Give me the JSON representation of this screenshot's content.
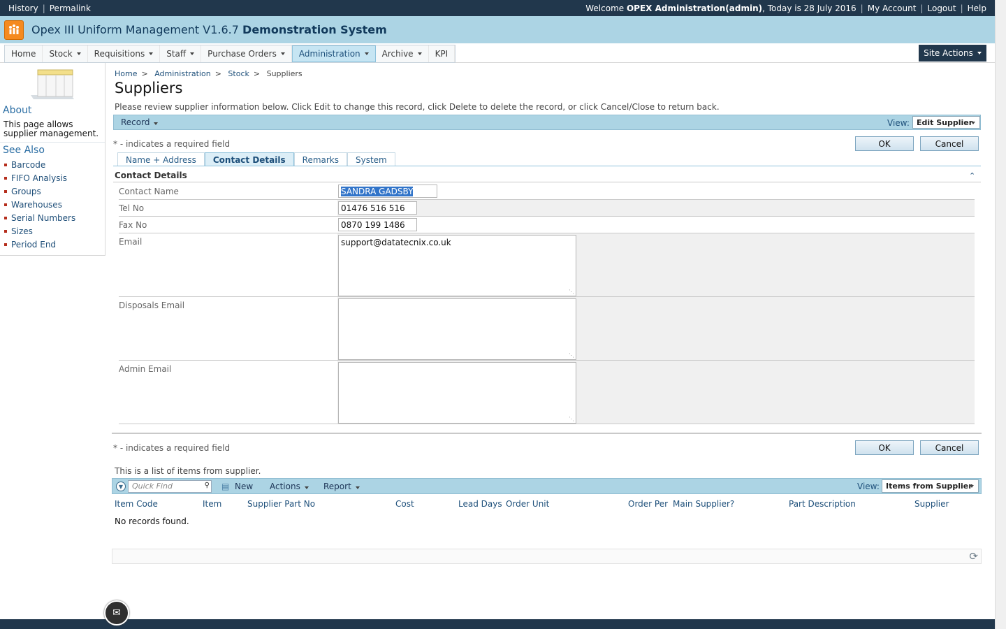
{
  "topbar": {
    "history": "History",
    "permalink": "Permalink",
    "welcome_prefix": "Welcome",
    "user": "OPEX Administration(admin)",
    "today": ", Today is 28 July 2016",
    "my_account": "My Account",
    "logout": "Logout",
    "help": "Help"
  },
  "header": {
    "app_title": "Opex III Uniform Management V1.6.7",
    "app_subtitle": "Demonstration System"
  },
  "nav": {
    "items": [
      {
        "label": "Home",
        "dropdown": false
      },
      {
        "label": "Stock",
        "dropdown": true
      },
      {
        "label": "Requisitions",
        "dropdown": true
      },
      {
        "label": "Staff",
        "dropdown": true
      },
      {
        "label": "Purchase Orders",
        "dropdown": true
      },
      {
        "label": "Administration",
        "dropdown": true,
        "active": true
      },
      {
        "label": "Archive",
        "dropdown": true
      },
      {
        "label": "KPI",
        "dropdown": false
      }
    ],
    "site_actions": "Site Actions"
  },
  "sidebar": {
    "about_title": "About",
    "about_text": "This page allows supplier management.",
    "see_also_title": "See Also",
    "links": [
      "Barcode",
      "FIFO Analysis",
      "Groups",
      "Warehouses",
      "Serial Numbers",
      "Sizes",
      "Period End"
    ]
  },
  "breadcrumb": {
    "home": "Home",
    "administration": "Administration",
    "stock": "Stock",
    "current": "Suppliers"
  },
  "page": {
    "title": "Suppliers",
    "description": "Please review supplier information below. Click Edit to change this record, click Delete to delete the record, or click Cancel/Close to return back."
  },
  "record_bar": {
    "record": "Record",
    "view_label": "View:",
    "view_value": "Edit Supplier"
  },
  "form": {
    "required_note": "* - indicates a required field",
    "ok": "OK",
    "cancel": "Cancel",
    "tabs": [
      "Name + Address",
      "Contact Details",
      "Remarks",
      "System"
    ],
    "active_tab": "Contact Details",
    "section_title": "Contact Details",
    "fields": {
      "contact_name": {
        "label": "Contact Name",
        "value": "SANDRA GADSBY"
      },
      "tel_no": {
        "label": "Tel No",
        "value": "01476 516 516"
      },
      "fax_no": {
        "label": "Fax No",
        "value": "0870 199 1486"
      },
      "email": {
        "label": "Email",
        "value": "support@datatecnix.co.uk"
      },
      "disposals_email": {
        "label": "Disposals Email",
        "value": ""
      },
      "admin_email": {
        "label": "Admin Email",
        "value": ""
      }
    }
  },
  "items_list": {
    "note": "This is a list of items from supplier.",
    "quick_find_placeholder": "Quick Find",
    "new": "New",
    "actions": "Actions",
    "report": "Report",
    "view_label": "View:",
    "view_value": "Items from Supplier",
    "columns": [
      "Item Code",
      "Item",
      "Supplier Part No",
      "Cost",
      "Lead Days",
      "Order Unit",
      "Order Per",
      "Main Supplier?",
      "Part Description",
      "Supplier"
    ],
    "empty_text": "No records found."
  },
  "colors": {
    "topbar": "#21374c",
    "titlebar": "#acd4e4",
    "accent": "#1d4f7a",
    "selection": "#3174c9"
  }
}
